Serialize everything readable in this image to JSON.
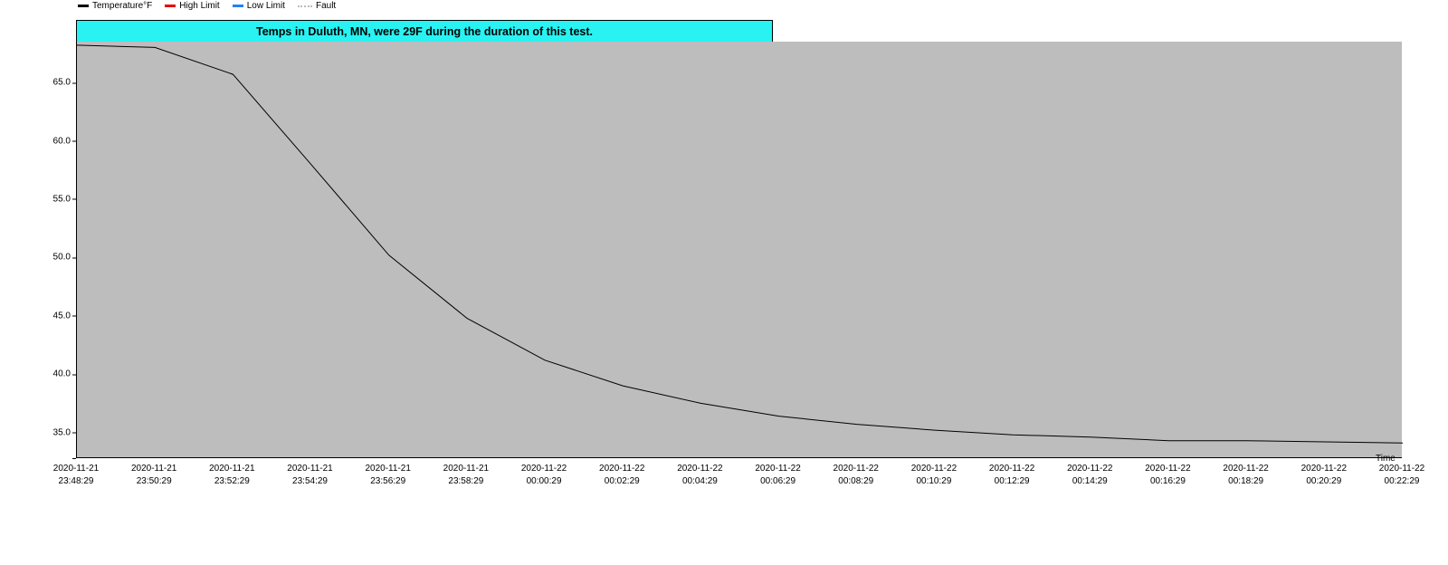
{
  "legend": {
    "items": [
      {
        "label": "Temperature°F",
        "color": "#000000"
      },
      {
        "label": "High Limit",
        "color": "#e60000"
      },
      {
        "label": "Low Limit",
        "color": "#2180ff"
      },
      {
        "label": "Fault",
        "color": "#bdbdbd",
        "dotted": true
      }
    ]
  },
  "annotation": "Temps in Duluth, MN, were 29F during the duration of this test.",
  "axis": {
    "x_title": "Time",
    "y_label": ""
  },
  "chart_data": {
    "type": "line",
    "title": "",
    "xlabel": "Time",
    "ylabel": "Temperature°F",
    "ylim": [
      32.8,
      68.5
    ],
    "y_ticks": [
      35.0,
      40.0,
      45.0,
      50.0,
      55.0,
      60.0,
      65.0
    ],
    "x_categories": [
      {
        "date": "2020-11-21",
        "time": "23:48:29"
      },
      {
        "date": "2020-11-21",
        "time": "23:50:29"
      },
      {
        "date": "2020-11-21",
        "time": "23:52:29"
      },
      {
        "date": "2020-11-21",
        "time": "23:54:29"
      },
      {
        "date": "2020-11-21",
        "time": "23:56:29"
      },
      {
        "date": "2020-11-21",
        "time": "23:58:29"
      },
      {
        "date": "2020-11-22",
        "time": "00:00:29"
      },
      {
        "date": "2020-11-22",
        "time": "00:02:29"
      },
      {
        "date": "2020-11-22",
        "time": "00:04:29"
      },
      {
        "date": "2020-11-22",
        "time": "00:06:29"
      },
      {
        "date": "2020-11-22",
        "time": "00:08:29"
      },
      {
        "date": "2020-11-22",
        "time": "00:10:29"
      },
      {
        "date": "2020-11-22",
        "time": "00:12:29"
      },
      {
        "date": "2020-11-22",
        "time": "00:14:29"
      },
      {
        "date": "2020-11-22",
        "time": "00:16:29"
      },
      {
        "date": "2020-11-22",
        "time": "00:18:29"
      },
      {
        "date": "2020-11-22",
        "time": "00:20:29"
      },
      {
        "date": "2020-11-22",
        "time": "00:22:29"
      }
    ],
    "series": [
      {
        "name": "Temperature°F",
        "color": "#000000",
        "values": [
          68.2,
          68.0,
          65.7,
          58.0,
          50.2,
          44.8,
          41.2,
          39.0,
          37.5,
          36.4,
          35.7,
          35.2,
          34.8,
          34.6,
          34.3,
          34.3,
          34.2,
          34.1
        ]
      }
    ],
    "annotation": "Temps in Duluth, MN, were 29F during the duration of this test."
  }
}
